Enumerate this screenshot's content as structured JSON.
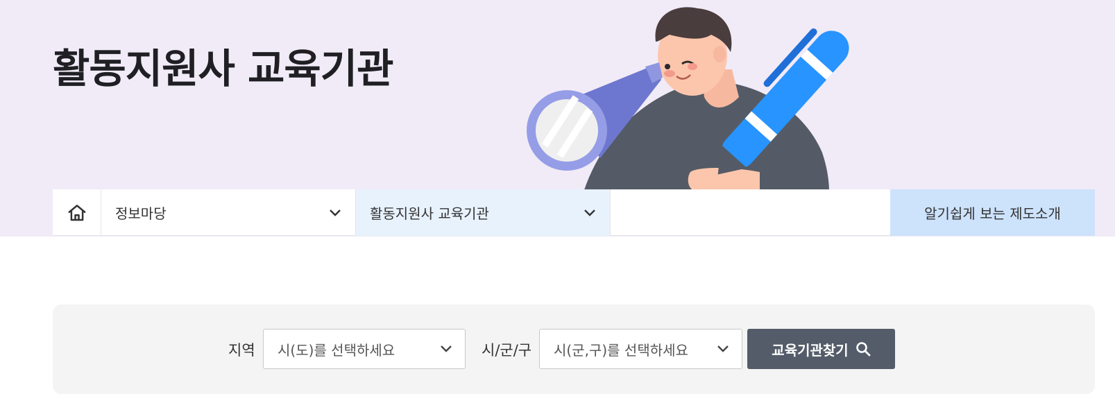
{
  "header": {
    "title": "활동지원사 교육기관"
  },
  "nav": {
    "home_icon": "home-icon",
    "menu1_label": "정보마당",
    "menu2_label": "활동지원사 교육기관",
    "intro_label": "알기쉽게 보는 제도소개"
  },
  "search": {
    "region_label": "지역",
    "region_placeholder": "시(도)를 선택하세요",
    "district_label": "시/군/구",
    "district_placeholder": "시(군,구)를 선택하세요",
    "find_button_label": "교육기관찾기",
    "find_icon": "search-icon"
  },
  "colors": {
    "hero_bg": "#f1ebf7",
    "nav_active_bg": "#e8f2fd",
    "intro_bg": "#cde2fb",
    "button_bg": "#535c68",
    "panel_bg": "#f4f4f4"
  }
}
